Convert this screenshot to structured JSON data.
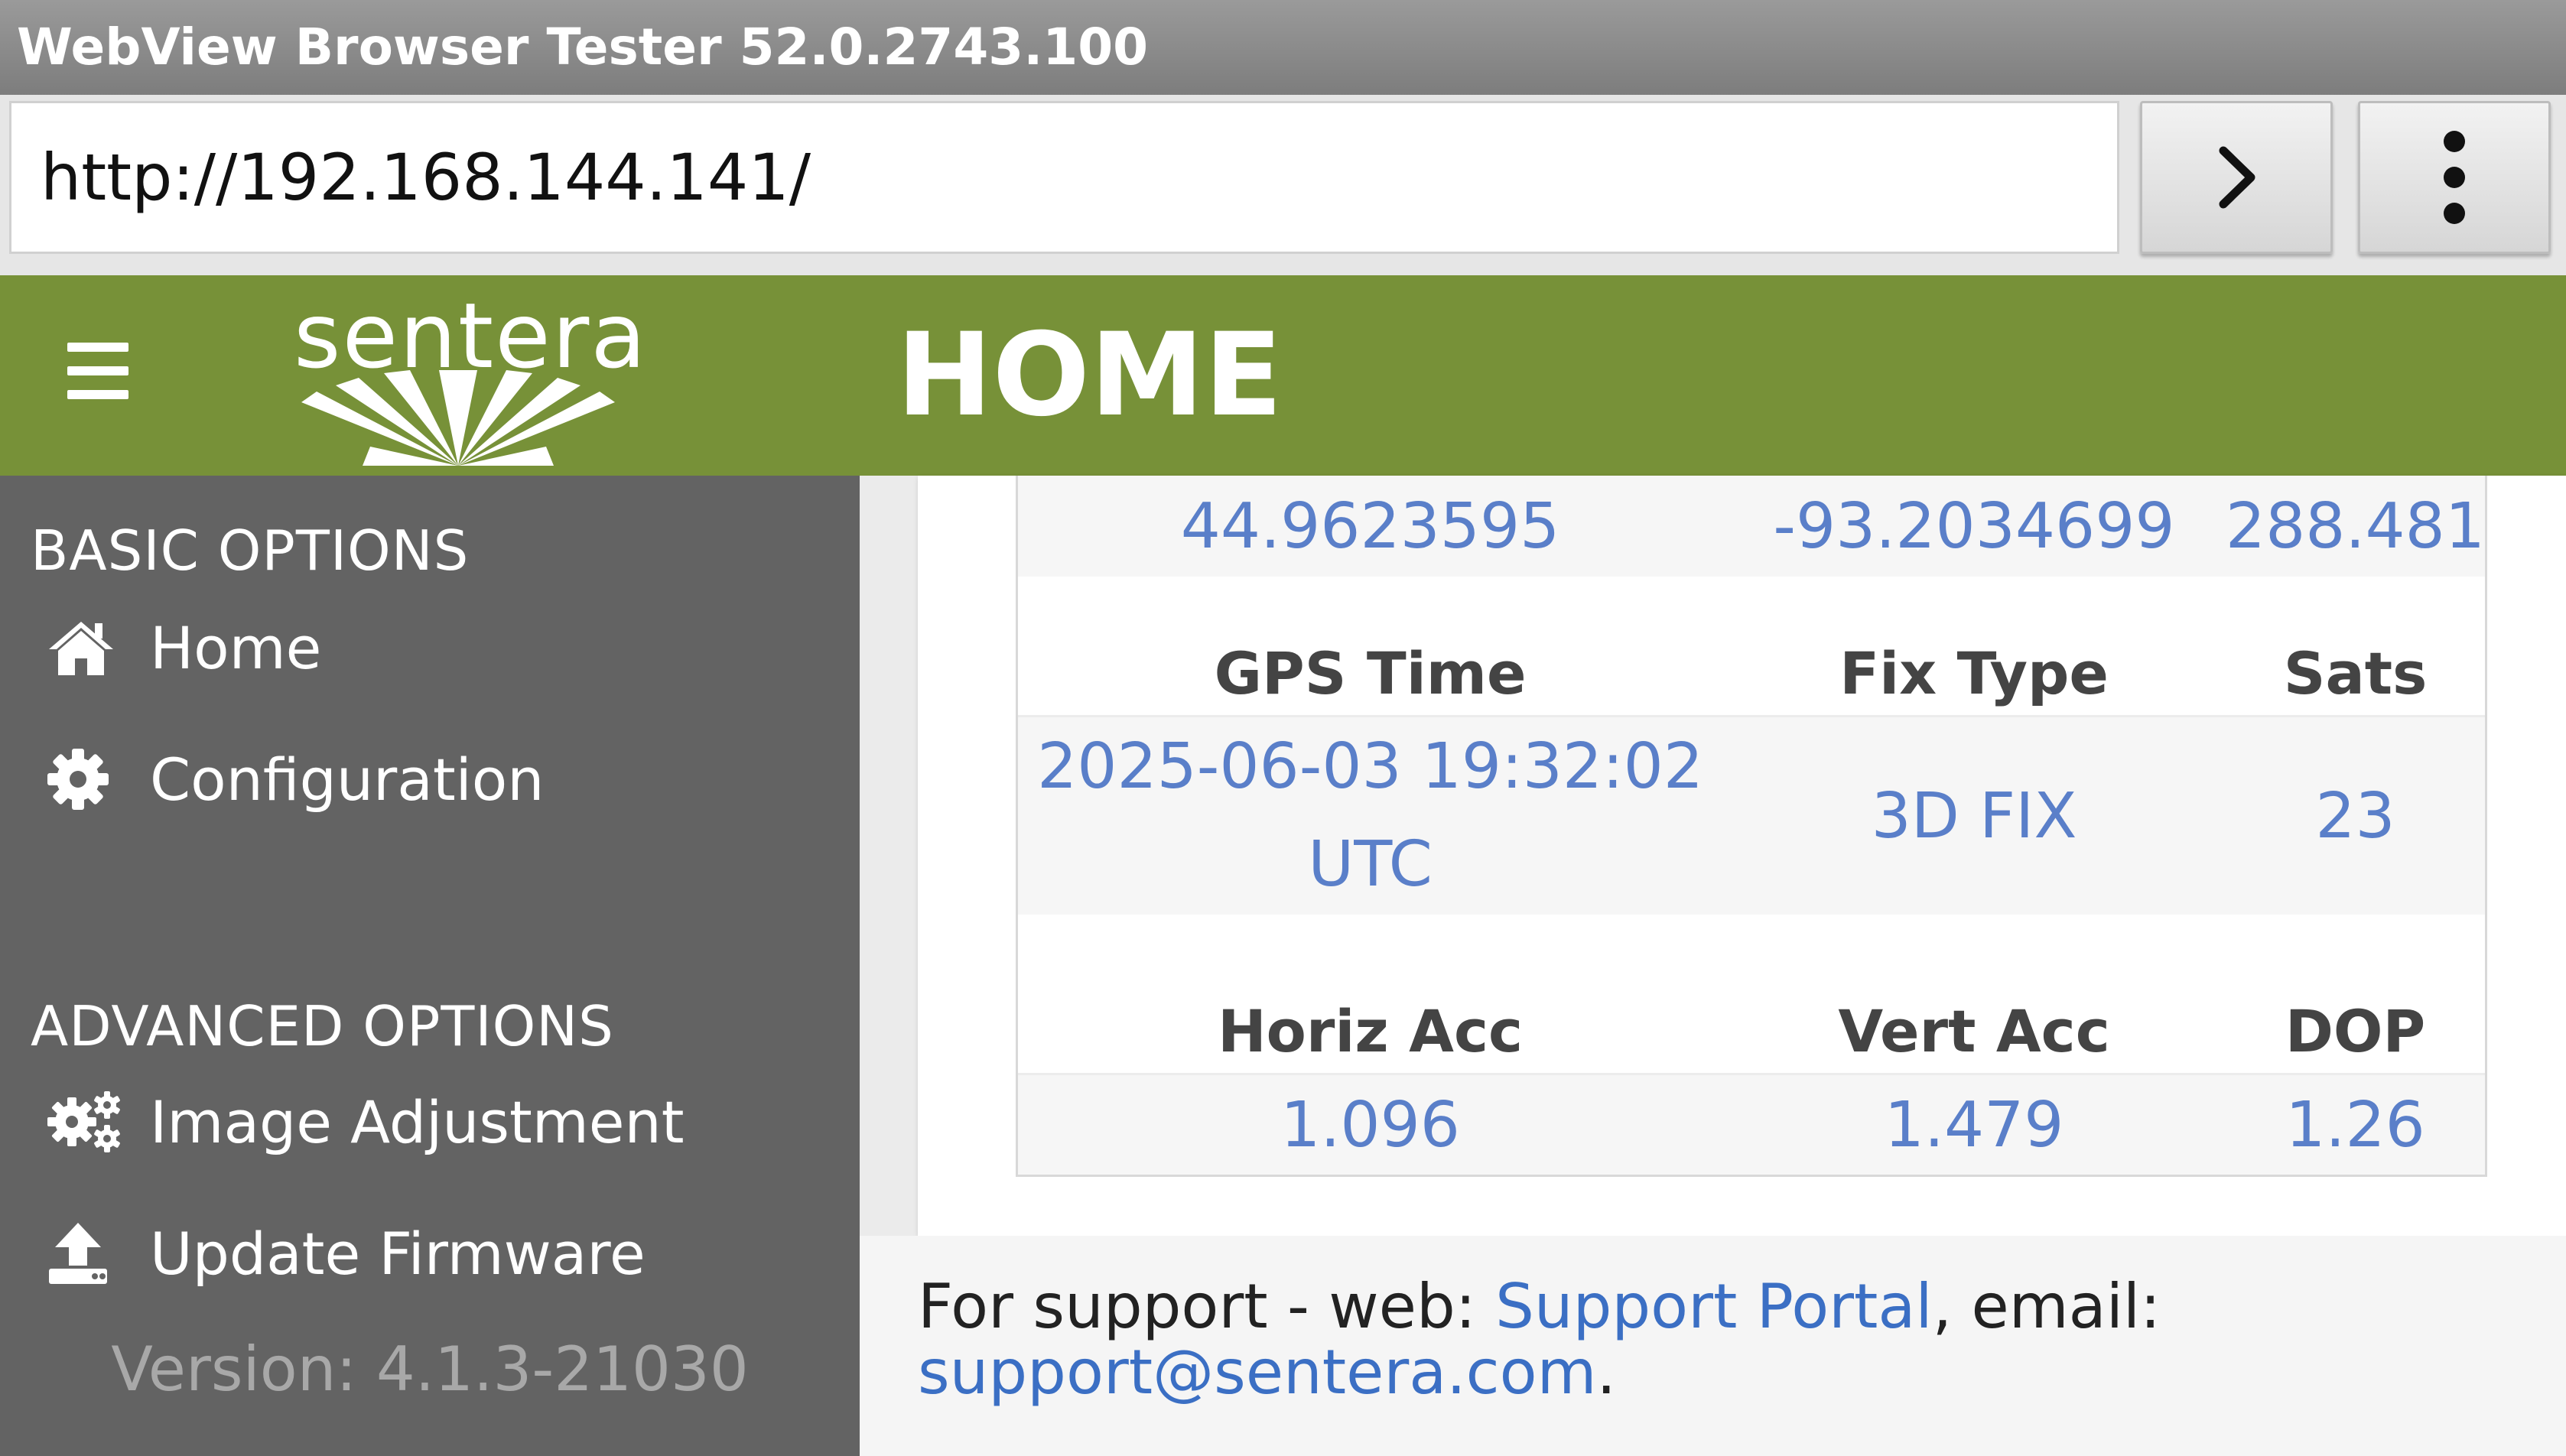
{
  "window": {
    "title": "WebView Browser Tester 52.0.2743.100"
  },
  "browser": {
    "url": "http://192.168.144.141/",
    "go_icon": "chevron-right-icon",
    "menu_icon": "more-vertical-icon"
  },
  "header": {
    "menu_icon": "hamburger-menu-icon",
    "logo_text": "sentera",
    "title": "HOME",
    "bg_color": "#779138"
  },
  "sidebar": {
    "basic_title": "BASIC OPTIONS",
    "basic_items": [
      {
        "label": "Home",
        "icon": "home-icon"
      },
      {
        "label": "Configuration",
        "icon": "gear-icon"
      }
    ],
    "advanced_title": "ADVANCED OPTIONS",
    "advanced_items": [
      {
        "label": "Image Adjustment",
        "icon": "gears-icon"
      },
      {
        "label": "Update Firmware",
        "icon": "upload-icon"
      }
    ],
    "version": "Version: 4.1.3-21030"
  },
  "gps": {
    "position_values": [
      "44.9623595",
      "-93.2034699",
      "288.481"
    ],
    "time_headers": [
      "GPS Time",
      "Fix Type",
      "Sats"
    ],
    "time_values": {
      "gps_time_line1": "2025-06-03 19:32:02",
      "gps_time_line2": "UTC",
      "fix_type": "3D FIX",
      "sats": "23"
    },
    "acc_headers": [
      "Horiz Acc",
      "Vert Acc",
      "DOP"
    ],
    "acc_values": [
      "1.096",
      "1.479",
      "1.26"
    ]
  },
  "footer": {
    "prefix": "For support - web: ",
    "portal_link": "Support Portal",
    "middle": ", email:",
    "email_link": "support@sentera.com",
    "suffix": "."
  }
}
